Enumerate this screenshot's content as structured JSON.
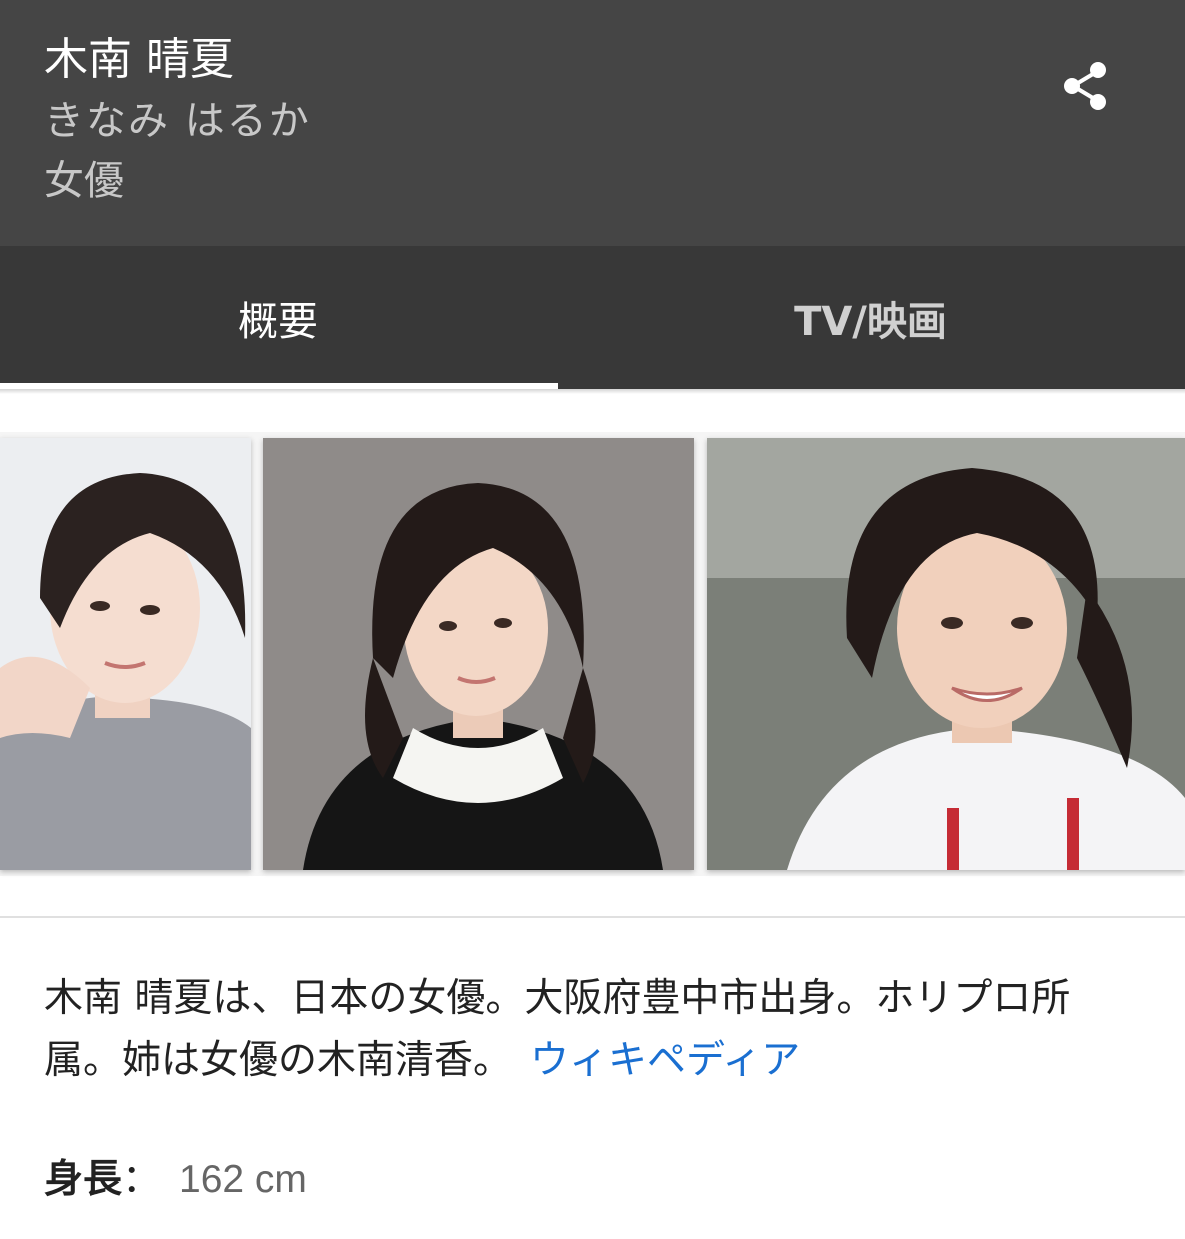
{
  "header": {
    "name": "木南 晴夏",
    "reading": "きなみ はるか",
    "occupation": "女優"
  },
  "tabs": [
    {
      "label": "概要",
      "selected": true
    },
    {
      "label": "TV/映画",
      "selected": false
    }
  ],
  "description": {
    "text": "木南 晴夏は、日本の女優。大阪府豊中市出身。ホリプロ所属。姉は女優の木南清香。",
    "source_link": "ウィキペディア"
  },
  "facts": [
    {
      "label": "身長",
      "separator": "：",
      "value": "162 cm"
    }
  ],
  "colors": {
    "header_bg": "#454545",
    "tabs_bg": "#383838",
    "link": "#1a6fd1"
  },
  "icons": {
    "share": "share-icon"
  }
}
